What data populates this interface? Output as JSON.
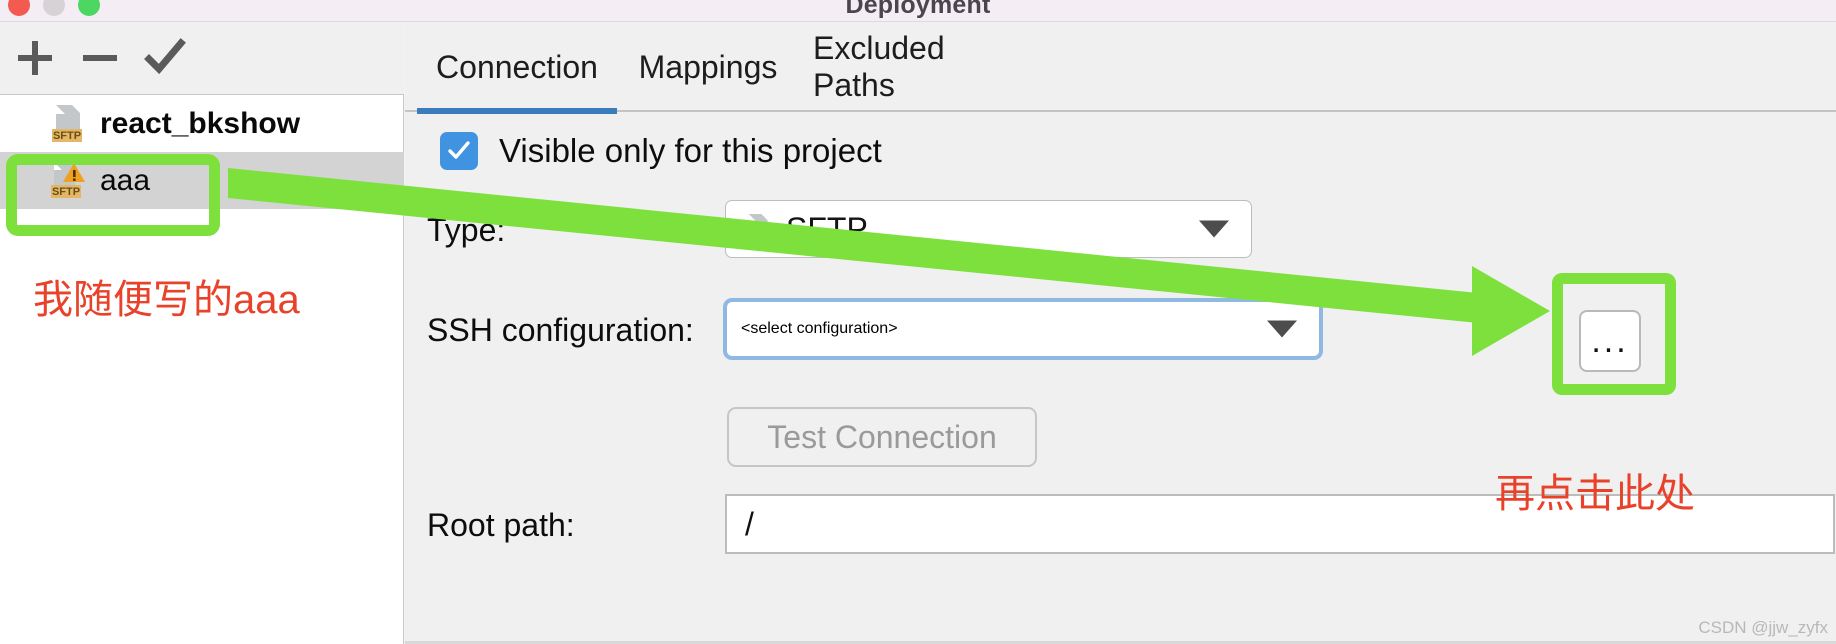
{
  "window": {
    "title": "Deployment",
    "controls": [
      "close",
      "minimize",
      "zoom"
    ]
  },
  "sidebar": {
    "toolbar": [
      {
        "name": "add",
        "glyph": "+"
      },
      {
        "name": "remove",
        "glyph": "−"
      },
      {
        "name": "confirm",
        "glyph": "✓"
      }
    ],
    "servers": [
      {
        "label": "react_bkshow",
        "type": "SFTP",
        "selected": false,
        "warning": false
      },
      {
        "label": "aaa",
        "type": "SFTP",
        "selected": true,
        "warning": true
      }
    ]
  },
  "tabs": [
    {
      "label": "Connection",
      "active": true
    },
    {
      "label": "Mappings",
      "active": false
    },
    {
      "label": "Excluded Paths",
      "active": false
    }
  ],
  "connection": {
    "visible_only_checkbox": {
      "label": "Visible only for this project",
      "checked": true
    },
    "type": {
      "label": "Type:",
      "value": "SFTP",
      "icon": "sftp-file-icon"
    },
    "ssh_configuration": {
      "label": "SSH configuration:",
      "placeholder": "<select configuration>",
      "value": "",
      "focused": true,
      "browse_button_label": "..."
    },
    "test_connection": {
      "label": "Test Connection",
      "enabled": false
    },
    "root_path": {
      "label": "Root path:",
      "value": "/"
    }
  },
  "annotations": [
    {
      "text": "我随便写的aaa",
      "color": "#e8422a",
      "target": "aaa-server-entry"
    },
    {
      "text": "再点击此处",
      "color": "#e8422a",
      "target": "ssh-browse-button"
    }
  ],
  "highlight_color": "#7ee03c",
  "accent_color": "#3b7cbd",
  "watermark": "CSDN @jjw_zyfx"
}
